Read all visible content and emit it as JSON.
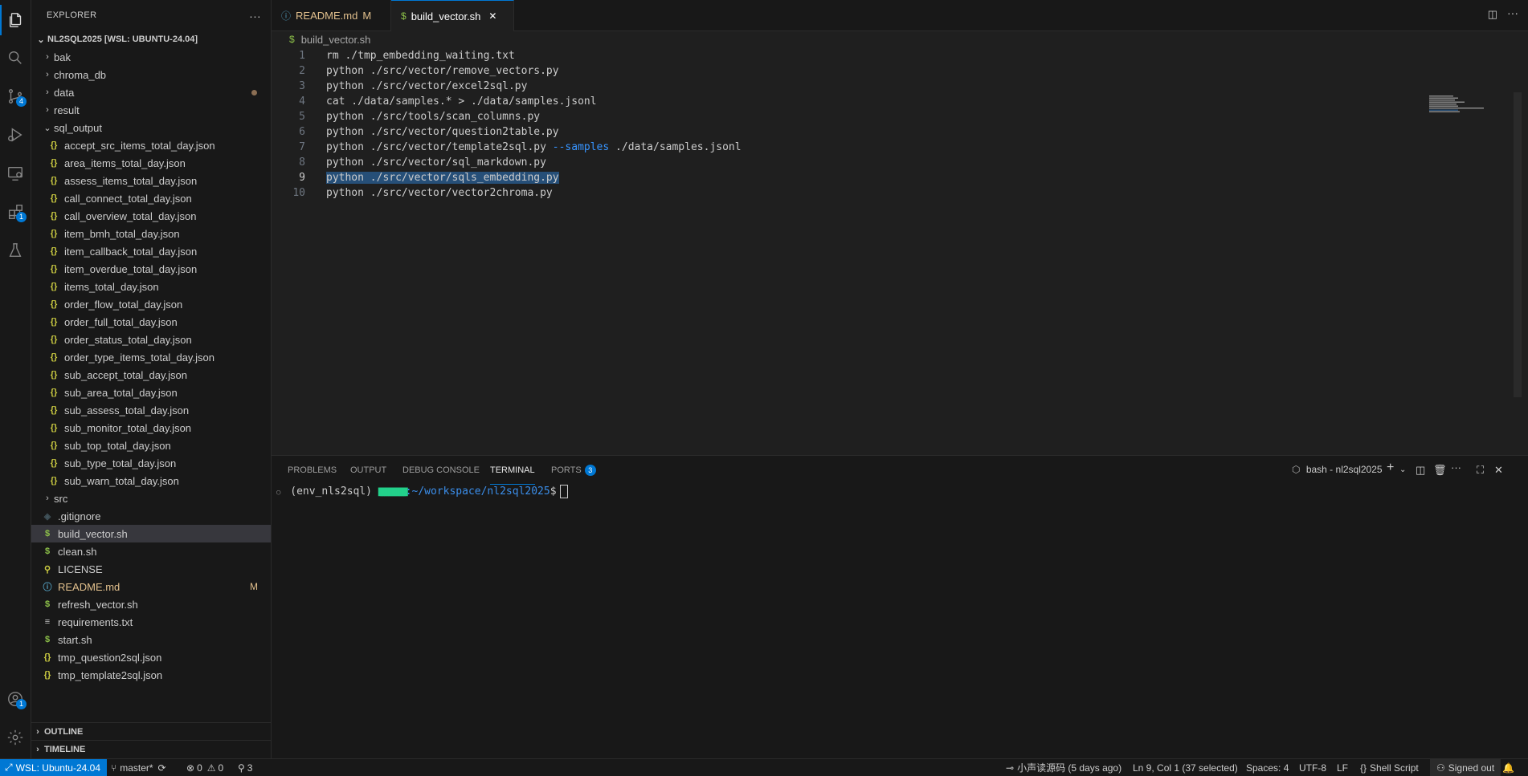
{
  "sidebar": {
    "title": "EXPLORER",
    "more": "···",
    "root": "NL2SQL2025 [WSL: UBUNTU-24.04]",
    "folders": [
      "bak",
      "chroma_db",
      "data",
      "result"
    ],
    "sql_output": "sql_output",
    "sql_files": [
      "accept_src_items_total_day.json",
      "area_items_total_day.json",
      "assess_items_total_day.json",
      "call_connect_total_day.json",
      "call_overview_total_day.json",
      "item_bmh_total_day.json",
      "item_callback_total_day.json",
      "item_overdue_total_day.json",
      "items_total_day.json",
      "order_flow_total_day.json",
      "order_full_total_day.json",
      "order_status_total_day.json",
      "order_type_items_total_day.json",
      "sub_accept_total_day.json",
      "sub_area_total_day.json",
      "sub_assess_total_day.json",
      "sub_monitor_total_day.json",
      "sub_top_total_day.json",
      "sub_type_total_day.json",
      "sub_warn_total_day.json"
    ],
    "src": "src",
    "gitignore": ".gitignore",
    "build_vector": "build_vector.sh",
    "clean": "clean.sh",
    "license": "LICENSE",
    "readme": "README.md",
    "readme_status": "M",
    "refresh": "refresh_vector.sh",
    "requirements": "requirements.txt",
    "start": "start.sh",
    "tmp_question": "tmp_question2sql.json",
    "tmp_template": "tmp_template2sql.json",
    "outline": "OUTLINE",
    "timeline": "TIMELINE"
  },
  "activity": {
    "scm_badge": "4",
    "ext_badge": "1",
    "account_badge": "1"
  },
  "tabs": {
    "readme": "README.md",
    "readme_status": "M",
    "build": "build_vector.sh",
    "close": "✕"
  },
  "breadcrumb": "build_vector.sh",
  "editor": {
    "lines": [
      {
        "n": "1",
        "code": "rm ./tmp_embedding_waiting.txt"
      },
      {
        "n": "2",
        "code": "python ./src/vector/remove_vectors.py"
      },
      {
        "n": "3",
        "code": "python ./src/vector/excel2sql.py"
      },
      {
        "n": "4",
        "code": "cat ./data/samples.* > ./data/samples.jsonl"
      },
      {
        "n": "5",
        "code": "python ./src/tools/scan_columns.py"
      },
      {
        "n": "6",
        "code": "python ./src/vector/question2table.py"
      },
      {
        "n": "7",
        "code_a": "python ./src/vector/template2sql.py ",
        "code_flag": "--samples",
        "code_b": " ./data/samples.jsonl"
      },
      {
        "n": "8",
        "code": "python ./src/vector/sql_markdown.py"
      },
      {
        "n": "9",
        "code": "python ./src/vector/sqls_embedding.py"
      },
      {
        "n": "10",
        "code": "python ./src/vector/vector2chroma.py"
      }
    ]
  },
  "panel": {
    "problems": "PROBLEMS",
    "output": "OUTPUT",
    "debug": "DEBUG CONSOLE",
    "terminal": "TERMINAL",
    "ports": "PORTS",
    "ports_count": "3",
    "shell": "bash - nl2sql2025",
    "prompt_env": "(env_nls2sql)",
    "prompt_user": "██████████████",
    "prompt_path": ":~/workspace/nl2sql2025",
    "prompt_end": "$"
  },
  "status": {
    "remote": "WSL: Ubuntu-24.04",
    "branch": "master*",
    "errors": "0",
    "warnings": "0",
    "ports": "3",
    "blame": "小声读源码 (5 days ago)",
    "cursor": "Ln 9, Col 1 (37 selected)",
    "spaces": "Spaces: 4",
    "encoding": "UTF-8",
    "eol": "LF",
    "language": "Shell Script",
    "account": "Signed out"
  }
}
